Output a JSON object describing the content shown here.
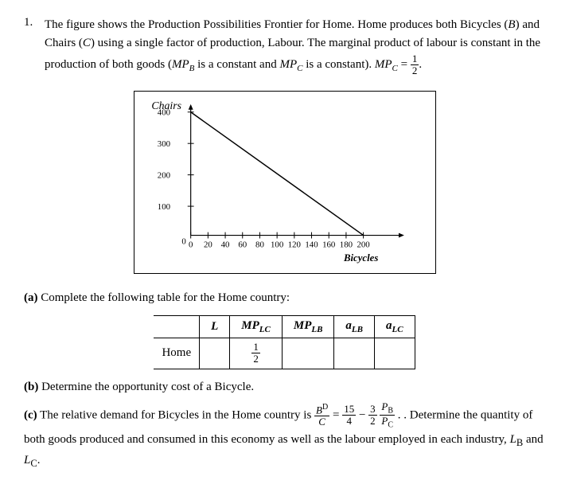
{
  "problem": {
    "number": "1.",
    "intro": "The figure shows the Production Possibilities Frontier for Home. Home produces both Bicycles (",
    "B_var": "B",
    "intro2": ") and Chairs (",
    "C_var": "C",
    "intro3": ") using a single factor of production, Labour. The marginal product of labour is constant in the production of both goods (",
    "MPL_B": "MPL",
    "MPL_B_sub": "B",
    "intro4": " is a constant and ",
    "MPL_C": "MPL",
    "MPL_C_sub": "C",
    "intro5": " is a constant). ",
    "MPL_C_eq": "MPL",
    "MPL_C_eq_sub": "C",
    "eq_val_num": "1",
    "eq_val_den": "2",
    "graph": {
      "y_label": "Chairs",
      "x_label": "Bicycles",
      "y_ticks": [
        0,
        100,
        200,
        300,
        400
      ],
      "x_ticks": [
        0,
        20,
        40,
        60,
        80,
        100,
        120,
        140,
        160,
        180,
        200
      ],
      "ppf_start": [
        0,
        400
      ],
      "ppf_end": [
        200,
        0
      ]
    },
    "part_a": {
      "label": "(a)",
      "text": "Complete the following table for the Home country:",
      "table": {
        "headers": [
          "L",
          "MPL_C",
          "MPL_B",
          "a_LB",
          "a_LC"
        ],
        "rows": [
          {
            "label": "Home",
            "L": "",
            "MPL_C": "1/2",
            "MPL_B": "",
            "a_LB": "",
            "a_LC": ""
          }
        ]
      }
    },
    "part_b": {
      "label": "(b)",
      "text": "Determine the opportunity cost of a Bicycle."
    },
    "part_c": {
      "label": "(c)",
      "text_before": "The relative demand for Bicycles in the Home country is",
      "rel_demand_num": "B",
      "rel_demand_den": "C",
      "superscript": "D",
      "equals": "=",
      "frac1_num": "15",
      "frac1_den": "4",
      "minus": "−",
      "frac2_num": "3",
      "frac2_den": "2",
      "price_num": "P",
      "price_sub": "B",
      "price_den": "P",
      "price_den_sub": "C",
      "text_after": ". Determine the quantity of both goods produced and consumed in this economy as well as the labour employed in each industry,",
      "L_B": "L",
      "L_B_sub": "B",
      "and": "and",
      "L_C": "L",
      "L_C_sub": "C"
    }
  }
}
